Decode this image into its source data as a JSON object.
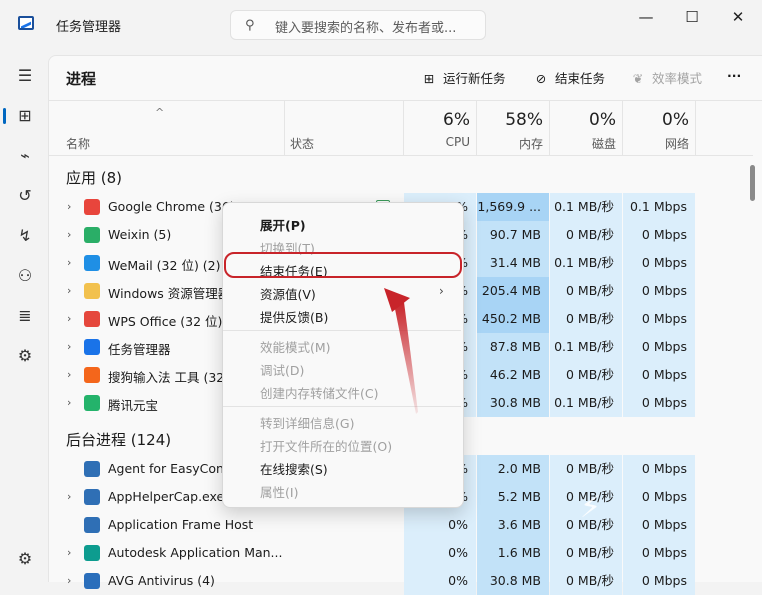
{
  "window": {
    "title": "任务管理器",
    "search_placeholder": "键入要搜索的名称、发布者或..."
  },
  "window_controls": {
    "minimize": "—",
    "maximize": "☐",
    "close": "✕"
  },
  "page": {
    "title": "进程"
  },
  "commands": {
    "run_new_task": "运行新任务",
    "end_task": "结束任务",
    "efficiency_mode": "效率模式",
    "more": "···"
  },
  "columns": {
    "name": "名称",
    "status": "状态",
    "cpu_pct": "6%",
    "cpu": "CPU",
    "mem_pct": "58%",
    "mem": "内存",
    "disk_pct": "0%",
    "disk": "磁盘",
    "net_pct": "0%",
    "net": "网络"
  },
  "sections": {
    "apps": "应用 (8)",
    "background": "后台进程 (124)"
  },
  "apps": [
    {
      "name": "Google Chrome (36)",
      "cpu": "0.2%",
      "mem": "1,569.9 ...",
      "disk": "0.1 MB/秒",
      "net": "0.1 Mbps",
      "icon": "chrome-icon"
    },
    {
      "name": "Weixin (5)",
      "cpu": "%",
      "mem": "90.7 MB",
      "disk": "0 MB/秒",
      "net": "0 Mbps",
      "icon": "weixin-icon"
    },
    {
      "name": "WeMail (32 位) (2)",
      "cpu": "%",
      "mem": "31.4 MB",
      "disk": "0.1 MB/秒",
      "net": "0 Mbps",
      "icon": "wemail-icon"
    },
    {
      "name": "Windows 资源管理器",
      "cpu": "%",
      "mem": "205.4 MB",
      "disk": "0 MB/秒",
      "net": "0 Mbps",
      "icon": "folder-icon"
    },
    {
      "name": "WPS Office (32 位) (",
      "cpu": "%",
      "mem": "450.2 MB",
      "disk": "0 MB/秒",
      "net": "0 Mbps",
      "icon": "wps-icon"
    },
    {
      "name": "任务管理器",
      "cpu": "%",
      "mem": "87.8 MB",
      "disk": "0.1 MB/秒",
      "net": "0 Mbps",
      "icon": "taskmgr-icon"
    },
    {
      "name": "搜狗输入法 工具 (32 -",
      "cpu": "%",
      "mem": "46.2 MB",
      "disk": "0 MB/秒",
      "net": "0 Mbps",
      "icon": "sogou-icon"
    },
    {
      "name": "腾讯元宝",
      "cpu": "%",
      "mem": "30.8 MB",
      "disk": "0.1 MB/秒",
      "net": "0 Mbps",
      "icon": "yuanbao-icon"
    }
  ],
  "background": [
    {
      "name": "Agent for EasyConn",
      "cpu": "%",
      "mem": "2.0 MB",
      "disk": "0 MB/秒",
      "net": "0 Mbps",
      "icon": "app-icon",
      "expand": false
    },
    {
      "name": "AppHelperCap.exe",
      "cpu": "%",
      "mem": "5.2 MB",
      "disk": "0 MB/秒",
      "net": "0 Mbps",
      "icon": "app-icon",
      "expand": true
    },
    {
      "name": "Application Frame Host",
      "cpu": "0%",
      "mem": "3.6 MB",
      "disk": "0 MB/秒",
      "net": "0 Mbps",
      "icon": "app-icon",
      "expand": false
    },
    {
      "name": "Autodesk Application Man...",
      "cpu": "0%",
      "mem": "1.6 MB",
      "disk": "0 MB/秒",
      "net": "0 Mbps",
      "icon": "autodesk-icon",
      "expand": true
    },
    {
      "name": "AVG Antivirus (4)",
      "cpu": "0%",
      "mem": "30.8 MB",
      "disk": "0 MB/秒",
      "net": "0 Mbps",
      "icon": "avg-icon",
      "expand": true
    }
  ],
  "context_menu": [
    {
      "label": "展开(P)",
      "enabled": true,
      "bold": true
    },
    {
      "label": "切换到(T)",
      "enabled": false
    },
    {
      "label": "结束任务(E)",
      "enabled": true
    },
    {
      "label": "资源值(V)",
      "enabled": true,
      "submenu": true
    },
    {
      "label": "提供反馈(B)",
      "enabled": true
    },
    {
      "label": "效能模式(M)",
      "enabled": false
    },
    {
      "label": "调试(D)",
      "enabled": false
    },
    {
      "label": "创建内存转储文件(C)",
      "enabled": false
    },
    {
      "label": "转到详细信息(G)",
      "enabled": false
    },
    {
      "label": "打开文件所在的位置(O)",
      "enabled": false
    },
    {
      "label": "在线搜索(S)",
      "enabled": true
    },
    {
      "label": "属性(I)",
      "enabled": false
    }
  ],
  "colors": {
    "accent": "#0067c0",
    "heat_light": "#dbeefb",
    "heat_mid": "#c2e2f8",
    "heat_strong": "#a8d4f5",
    "annotation": "#c8242a"
  }
}
